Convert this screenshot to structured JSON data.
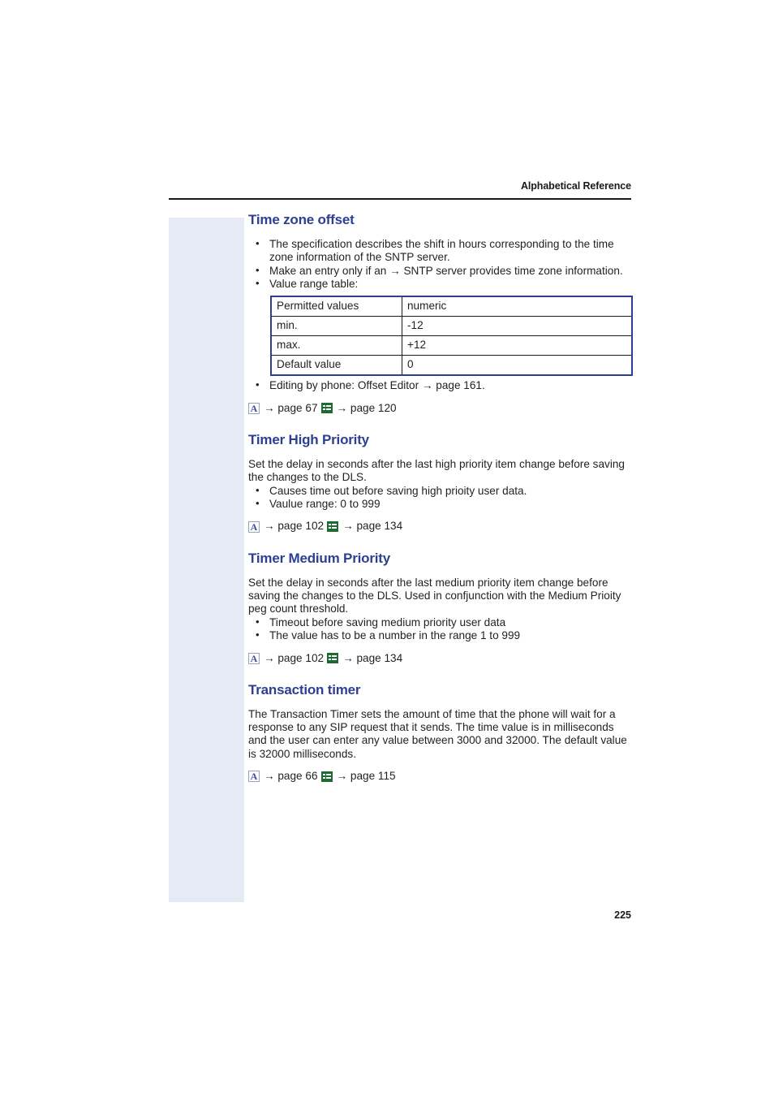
{
  "header": {
    "running_head": "Alphabetical Reference"
  },
  "folio": {
    "page_number": "225"
  },
  "icons": {
    "admin_icon_letter": "A",
    "admin_icon_name": "letter-a-icon",
    "list_icon_name": "list-form-icon",
    "arrow_glyph": "→"
  },
  "colors": {
    "heading_blue": "#2e3f93",
    "margin_bar": "#e6eaf5",
    "table_outer_border": "#2e3f93",
    "table_inner_border": "#1a1a1a",
    "icon_green": "#1d6b33",
    "icon_a_blue": "#3b4fa8"
  },
  "sections": [
    {
      "id": "time-zone-offset",
      "title": "Time zone offset",
      "bullets": [
        "The specification describes the shift in hours corresponding to the time zone information of the SNTP server.",
        "Make an entry only if an → SNTP server provides time zone information.",
        "Value range table:"
      ],
      "table": {
        "rows": [
          {
            "label": "Permitted values",
            "value": "numeric"
          },
          {
            "label": "min.",
            "value": "-12"
          },
          {
            "label": "max.",
            "value": "+12"
          },
          {
            "label": "Default value",
            "value": "0"
          }
        ]
      },
      "bullets_after_table": [
        "Editing by phone: Offset Editor → page 161."
      ],
      "xref": {
        "first": "→ page 67",
        "second": "→ page 120"
      }
    },
    {
      "id": "timer-high-priority",
      "title": "Timer High Priority",
      "paragraph": "Set the delay in seconds after the last high priority item change before saving the changes to the DLS.",
      "bullets": [
        "Causes time out before saving high prioity user data.",
        "Vaulue range: 0 to 999"
      ],
      "xref": {
        "first": "→ page 102",
        "second": "→ page 134"
      }
    },
    {
      "id": "timer-medium-priority",
      "title": "Timer Medium Priority",
      "paragraph": "Set the delay in seconds after the last medium priority item change before saving the changes to the DLS. Used in confjunction with the Medium Prioity peg count threshold.",
      "bullets": [
        "Timeout before saving medium priority user data",
        "The value has to be a number in the range 1 to 999"
      ],
      "xref": {
        "first": "→ page 102",
        "second": "→ page 134"
      }
    },
    {
      "id": "transaction-timer",
      "title": "Transaction timer",
      "paragraph": "The Transaction Timer sets the amount of time that the phone will wait for a response to any SIP request that it sends. The time value is in milliseconds and the user can enter any value between 3000 and 32000. The default value is 32000 milliseconds.",
      "bullets": [],
      "xref": {
        "first": "→ page 66",
        "second": "→ page 115"
      }
    }
  ]
}
